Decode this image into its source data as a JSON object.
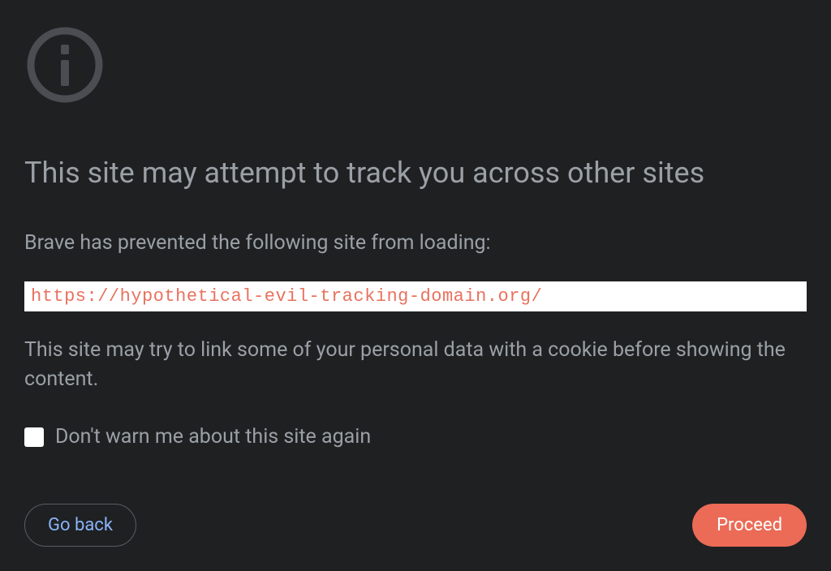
{
  "title": "This site may attempt to track you across other sites",
  "description": "Brave has prevented the following site from loading:",
  "url": "https://hypothetical-evil-tracking-domain.org/",
  "warning": "This site may try to link some of your personal data with a cookie before showing the content.",
  "checkbox_label": "Don't warn me about this site again",
  "buttons": {
    "go_back": "Go back",
    "proceed": "Proceed"
  }
}
